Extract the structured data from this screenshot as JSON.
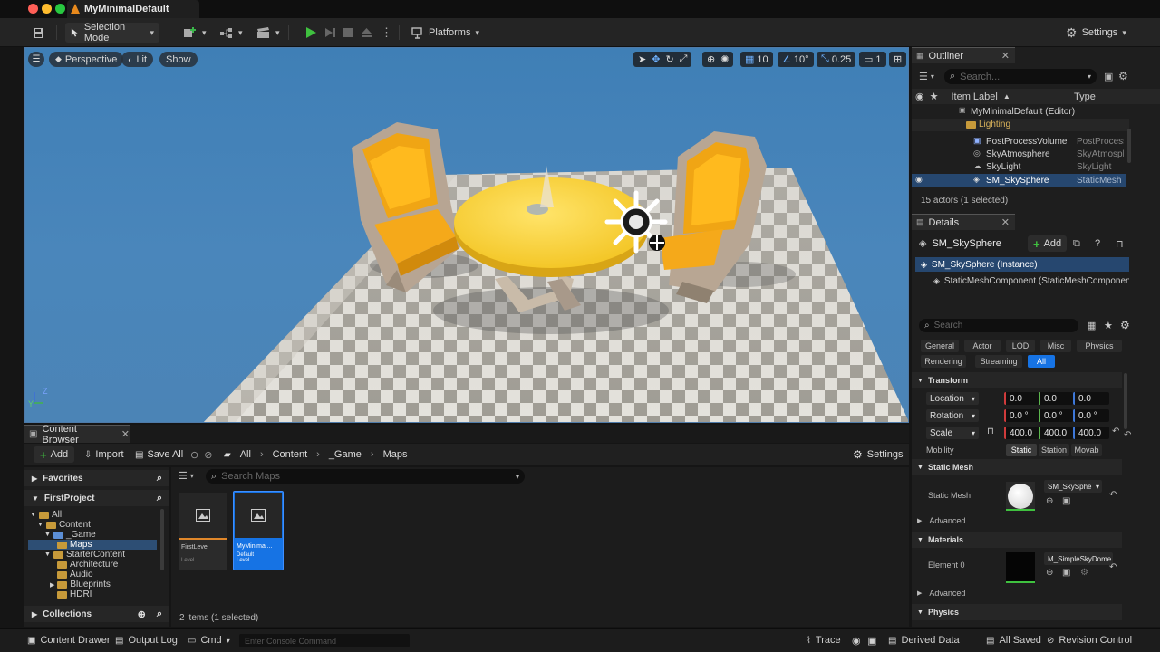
{
  "window": {
    "title": "MyMinimalDefault"
  },
  "toolbar": {
    "selection_mode": "Selection Mode",
    "platforms": "Platforms",
    "settings": "Settings"
  },
  "viewport": {
    "perspective": "Perspective",
    "lit": "Lit",
    "show": "Show",
    "grid_snap": "10",
    "rotation_snap": "10°",
    "scale_snap": "0.25",
    "camera_speed": "1",
    "axis_z": "Z",
    "axis_y": "Y"
  },
  "content_browser": {
    "tab": "Content Browser",
    "add": "Add",
    "import": "Import",
    "save_all": "Save All",
    "breadcrumb": [
      "All",
      "Content",
      "_Game",
      "Maps"
    ],
    "settings": "Settings",
    "favorites": "Favorites",
    "project": "FirstProject",
    "search_placeholder": "Search Maps",
    "tree": [
      "All",
      "Content",
      "_Game",
      "Maps",
      "StarterContent",
      "Architecture",
      "Audio",
      "Blueprints",
      "HDRI"
    ],
    "collections": "Collections",
    "assets": [
      {
        "name": "FirstLevel",
        "type": "Level"
      },
      {
        "name": "MyMinimal...",
        "type": "Default Level"
      }
    ],
    "status": "2 items (1 selected)"
  },
  "outliner": {
    "tab": "Outliner",
    "search_placeholder": "Search...",
    "col_label": "Item Label",
    "col_type": "Type",
    "rows": [
      {
        "label": "MyMinimalDefault (Editor)",
        "type": ""
      },
      {
        "label": "Lighting",
        "type": ""
      },
      {
        "label": "PostProcessVolume",
        "type": "PostProcess"
      },
      {
        "label": "SkyAtmosphere",
        "type": "SkyAtmospl"
      },
      {
        "label": "SkyLight",
        "type": "SkyLight"
      },
      {
        "label": "SM_SkySphere",
        "type": "StaticMesh"
      }
    ],
    "status": "15 actors (1 selected)"
  },
  "details": {
    "tab": "Details",
    "actor": "SM_SkySphere",
    "add": "Add",
    "instance": "SM_SkySphere (Instance)",
    "component": "StaticMeshComponent (StaticMeshComponent)",
    "search_placeholder": "Search",
    "filters": [
      "General",
      "Actor",
      "LOD",
      "Misc",
      "Physics",
      "Rendering",
      "Streaming",
      "All"
    ],
    "transform": {
      "section": "Transform",
      "location_label": "Location",
      "location": [
        "0.0",
        "0.0",
        "0.0"
      ],
      "rotation_label": "Rotation",
      "rotation": [
        "0.0 °",
        "0.0 °",
        "0.0 °"
      ],
      "scale_label": "Scale",
      "scale": [
        "400.0",
        "400.0",
        "400.0"
      ],
      "mobility_label": "Mobility",
      "mobility": [
        "Static",
        "Station",
        "Movab"
      ]
    },
    "static_mesh": {
      "section": "Static Mesh",
      "label": "Static Mesh",
      "value": "SM_SkySphe",
      "advanced": "Advanced"
    },
    "materials": {
      "section": "Materials",
      "label": "Element 0",
      "value": "M_SimpleSkyDome",
      "advanced": "Advanced"
    },
    "physics": "Physics"
  },
  "bottom": {
    "content_drawer": "Content Drawer",
    "output_log": "Output Log",
    "cmd": "Cmd",
    "console_placeholder": "Enter Console Command",
    "trace": "Trace",
    "derived_data": "Derived Data",
    "all_saved": "All Saved",
    "revision_control": "Revision Control"
  }
}
